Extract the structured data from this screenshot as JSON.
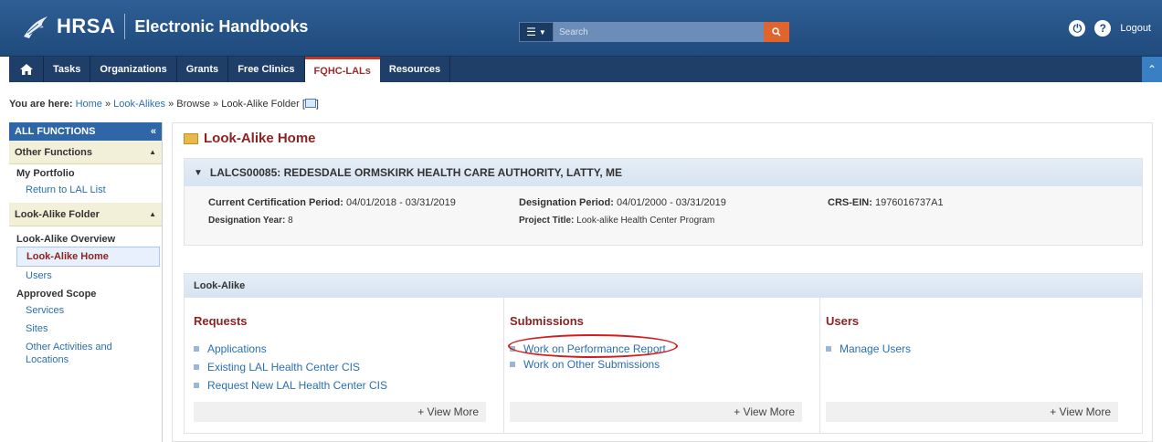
{
  "header": {
    "logo_text": "HRSA",
    "app_title": "Electronic Handbooks",
    "search_placeholder": "Search",
    "logout_label": "Logout"
  },
  "nav": {
    "items": [
      {
        "label": "Tasks"
      },
      {
        "label": "Organizations"
      },
      {
        "label": "Grants"
      },
      {
        "label": "Free Clinics"
      },
      {
        "label": "FQHC-LALs"
      },
      {
        "label": "Resources"
      }
    ],
    "active_index": 4
  },
  "breadcrumb": {
    "prefix": "You are here:",
    "home": "Home",
    "lookalikes": "Look-Alikes",
    "sep": "»",
    "browse": "Browse",
    "folder": "Look-Alike Folder"
  },
  "sidebar": {
    "header": "ALL FUNCTIONS",
    "other_functions": "Other Functions",
    "my_portfolio": "My Portfolio",
    "return_link": "Return to LAL List",
    "lal_folder": "Look-Alike Folder",
    "overview": "Look-Alike Overview",
    "home": "Look-Alike Home",
    "users": "Users",
    "approved_scope": "Approved Scope",
    "services": "Services",
    "sites": "Sites",
    "other_activities": "Other Activities and Locations"
  },
  "main": {
    "title": "Look-Alike Home",
    "org_header": "LALCS00085: REDESDALE ORMSKIRK HEALTH CARE AUTHORITY, LATTY, ME",
    "cert_period_label": "Current Certification Period:",
    "cert_period_value": "04/01/2018 - 03/31/2019",
    "designation_period_label": "Designation Period:",
    "designation_period_value": "04/01/2000 - 03/31/2019",
    "crs_ein_label": "CRS-EIN:",
    "crs_ein_value": "1976016737A1",
    "designation_year_label": "Designation Year:",
    "designation_year_value": "8",
    "project_title_label": "Project Title:",
    "project_title_value": "Look-alike Health Center Program",
    "section_header": "Look-Alike",
    "columns": {
      "requests": {
        "title": "Requests",
        "items": [
          "Applications",
          "Existing LAL Health Center CIS",
          "Request New LAL Health Center CIS"
        ],
        "view_more": "+ View More"
      },
      "submissions": {
        "title": "Submissions",
        "items": [
          "Work on Performance Report",
          "Work on Other Submissions"
        ],
        "view_more": "+ View More"
      },
      "users": {
        "title": "Users",
        "items": [
          "Manage Users"
        ],
        "view_more": "+ View More"
      }
    }
  },
  "colors": {
    "header_blue": "#1f4a7c",
    "nav_blue": "#1f3f69",
    "accent_red": "#8b2323",
    "link_blue": "#2a6fb0",
    "search_orange": "#e0642e"
  }
}
